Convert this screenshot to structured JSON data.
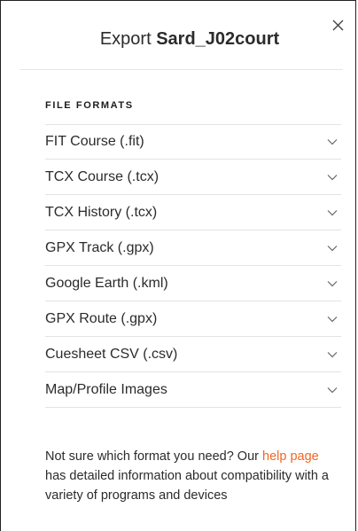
{
  "modal": {
    "title_prefix": "Export",
    "route_name": "Sard_J02court",
    "close_icon": "close-icon"
  },
  "formats": {
    "section_label": "FILE FORMATS",
    "items": [
      {
        "label": "FIT Course (.fit)"
      },
      {
        "label": "TCX Course (.tcx)"
      },
      {
        "label": "TCX History (.tcx)"
      },
      {
        "label": "GPX Track (.gpx)"
      },
      {
        "label": "Google Earth (.kml)"
      },
      {
        "label": "GPX Route (.gpx)"
      },
      {
        "label": "Cuesheet CSV (.csv)"
      },
      {
        "label": "Map/Profile Images"
      }
    ],
    "expand_icon": "chevron-down-icon"
  },
  "help": {
    "text_before": "Not sure which format you need? Our ",
    "link_text": "help page",
    "text_after": " has detailed information about compatibility with a variety of programs and devices"
  },
  "colors": {
    "link": "#f26522",
    "text": "#2b2b2b",
    "divider": "#e3e3e3"
  }
}
